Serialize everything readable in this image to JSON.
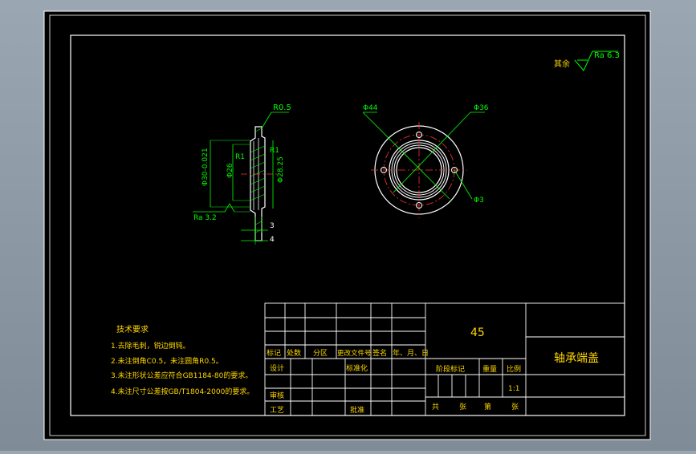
{
  "surface_finish_note": {
    "prefix": "其余",
    "value": "Ra 6.3"
  },
  "side_view": {
    "radius_top": "R0.5",
    "r1_left": "R1",
    "r1_right": "R1",
    "dia_outer": "Φ30-0.021",
    "dia_inner": "Φ26",
    "dia_right": "Φ28.25",
    "roughness": "Ra 3.2",
    "dim_3": "3",
    "dim_4": "4"
  },
  "front_view": {
    "dia_44": "Φ44",
    "dia_36": "Φ36",
    "dia_3": "Φ3"
  },
  "tech_requirements": {
    "title": "技术要求",
    "items": [
      "1.去除毛刺，锐边倒钝。",
      "2.未注倒角C0.5，未注圆角R0.5。",
      "3.未注形状公差应符合GB1184-80的要求。",
      "4.未注尺寸公差按GB/T1804-2000的要求。"
    ]
  },
  "title_block": {
    "material": "45",
    "part_name": "轴承端盖",
    "headers": {
      "mark": "标记",
      "count": "处数",
      "zone": "分区",
      "change_doc": "更改文件号",
      "signature": "签名",
      "date": "年、月、日"
    },
    "design": "设计",
    "standardize": "标准化",
    "review": "审核",
    "process": "工艺",
    "approve": "批准",
    "stage_mark": "阶段标记",
    "weight": "重量",
    "scale_label": "比例",
    "scale": "1:1",
    "sheets_total": "共",
    "sheet_unit_a": "张",
    "sheet_no": "第",
    "sheet_unit_b": "张"
  }
}
